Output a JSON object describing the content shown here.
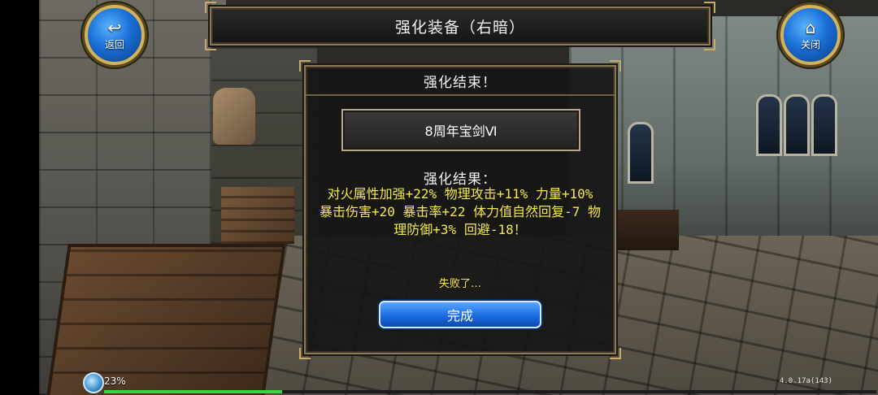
{
  "header": {
    "title": "强化装备（右暗）"
  },
  "nav": {
    "back": {
      "label": "返回",
      "icon": "return-arrow-icon"
    },
    "close": {
      "label": "关闭",
      "icon": "home-icon"
    }
  },
  "dialog": {
    "title": "强化结束！",
    "item_name": "8周年宝剑Ⅵ",
    "result_heading": "强化结果：",
    "result_text": "对火属性加强+22% 物理攻击+11% 力量+10% 暴击伤害+20 暴击率+22 体力值自然回复-7 物理防御+3% 回避-18！",
    "status": "失败了…",
    "done_button": "完成"
  },
  "status_bar": {
    "percent_label": "23%",
    "progress": 0.23,
    "version": "4.0.17a(143)"
  },
  "colors": {
    "accent_blue": "#1b6be0",
    "result_yellow": "#f5e94a",
    "frame_gold": "#c9a96a",
    "progress_green": "#3fd13f"
  }
}
